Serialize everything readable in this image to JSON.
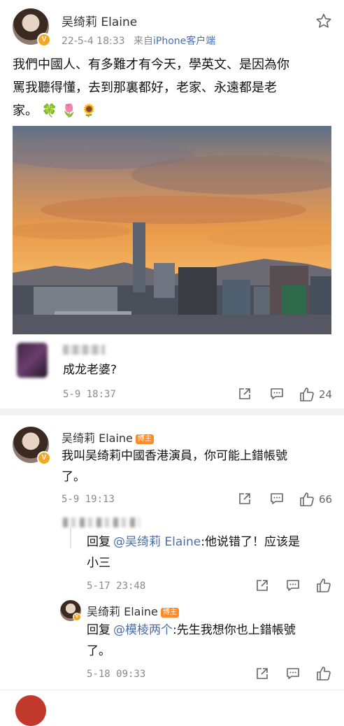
{
  "post": {
    "author": "吴绮莉 Elaine",
    "verified_badge": "V",
    "date": "22-5-4 18:33",
    "source_prefix": "来自",
    "source": "iPhone客户端",
    "text_line1": "我們中國人、有多難才有今天，學英文、是因為你",
    "text_line2": "罵我聽得懂，去到那裏都好，老家、永遠都是老",
    "text_line3": "家。",
    "emojis": [
      "🍀",
      "🌷",
      "🌻"
    ]
  },
  "comment1": {
    "text": "成龙老婆?",
    "time": "5-9 18:37",
    "like_count": "24"
  },
  "comment2": {
    "author": "吴绮莉 Elaine",
    "badge": "博主",
    "text_line1": "我叫吴绮莉中國香港演員，你可能上錯帳號",
    "text_line2": "了。",
    "time": "5-9 19:13",
    "like_count": "66"
  },
  "reply1": {
    "prefix": "回复",
    "mention": "@吴绮莉 Elaine",
    "text_line1": ":他说错了！应该是",
    "text_line2": "小三",
    "time": "5-17 23:48"
  },
  "reply2": {
    "author": "吴绮莉 Elaine",
    "badge": "博主",
    "prefix": "回复",
    "mention": "@模棱两个",
    "text_line1": ":先生我想你也上錯帳號",
    "text_line2": "了。",
    "time": "5-18 09:33"
  },
  "colors": {
    "link_blue": "#4a6ea8",
    "badge_orange": "#ff8a2a",
    "verified_gold": "#f5a623"
  }
}
